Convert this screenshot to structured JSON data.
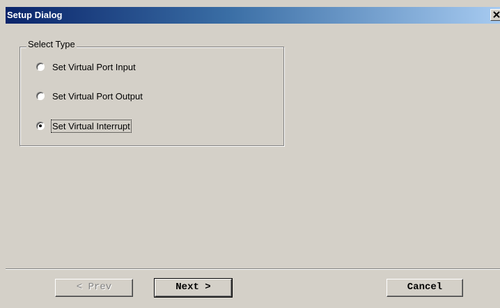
{
  "window": {
    "title": "Setup Dialog",
    "close_glyph": "✕",
    "close_icon": "close-icon"
  },
  "group": {
    "legend": "Select Type",
    "options": [
      {
        "label": "Set Virtual Port Input",
        "selected": false
      },
      {
        "label": "Set Virtual Port Output",
        "selected": false
      },
      {
        "label": "Set Virtual Interrupt",
        "selected": true
      }
    ]
  },
  "buttons": {
    "prev_label": "< Prev",
    "prev_enabled": false,
    "next_label": "Next >",
    "cancel_label": "Cancel"
  },
  "colors": {
    "face": "#d4d0c8",
    "title_start": "#0a246a",
    "title_end": "#a6caf0",
    "disabled_text": "#808080"
  }
}
